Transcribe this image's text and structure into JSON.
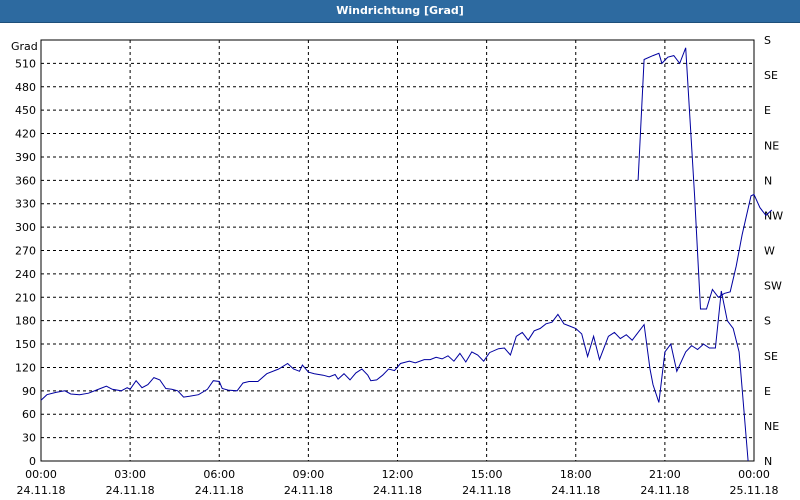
{
  "window": {
    "title": "Windrichtung [Grad]"
  },
  "chart_data": {
    "type": "line",
    "title": "Windrichtung [Grad]",
    "ylabel": "Grad",
    "xlabel": "",
    "ylim": [
      0,
      540
    ],
    "yticks": [
      0,
      30,
      60,
      90,
      120,
      150,
      180,
      210,
      240,
      270,
      300,
      330,
      360,
      390,
      420,
      450,
      480,
      510
    ],
    "xlim_hours": [
      0,
      24
    ],
    "xticks": [
      {
        "hour": 0,
        "time": "00:00",
        "date": "24.11.18"
      },
      {
        "hour": 3,
        "time": "03:00",
        "date": "24.11.18"
      },
      {
        "hour": 6,
        "time": "06:00",
        "date": "24.11.18"
      },
      {
        "hour": 9,
        "time": "09:00",
        "date": "24.11.18"
      },
      {
        "hour": 12,
        "time": "12:00",
        "date": "24.11.18"
      },
      {
        "hour": 15,
        "time": "15:00",
        "date": "24.11.18"
      },
      {
        "hour": 18,
        "time": "18:00",
        "date": "24.11.18"
      },
      {
        "hour": 21,
        "time": "21:00",
        "date": "24.11.18"
      },
      {
        "hour": 24,
        "time": "00:00",
        "date": "25.11.18"
      }
    ],
    "right_axis": [
      {
        "value": 0,
        "label": "N"
      },
      {
        "value": 45,
        "label": "NE"
      },
      {
        "value": 90,
        "label": "E"
      },
      {
        "value": 135,
        "label": "SE"
      },
      {
        "value": 180,
        "label": "S"
      },
      {
        "value": 225,
        "label": "SW"
      },
      {
        "value": 270,
        "label": "W"
      },
      {
        "value": 315,
        "label": "NW"
      },
      {
        "value": 360,
        "label": "N"
      },
      {
        "value": 405,
        "label": "NE"
      },
      {
        "value": 450,
        "label": "E"
      },
      {
        "value": 495,
        "label": "SE"
      },
      {
        "value": 540,
        "label": "S"
      }
    ],
    "grid": true,
    "colors": {
      "line": "#0000a0",
      "grid": "#000000",
      "titlebar": "#2d6aa0"
    },
    "series": [
      {
        "segments": [
          [
            [
              0,
              78
            ],
            [
              0.2,
              85
            ],
            [
              0.5,
              88
            ],
            [
              0.8,
              90
            ],
            [
              1.0,
              86
            ],
            [
              1.3,
              85
            ],
            [
              1.6,
              87
            ],
            [
              2.0,
              93
            ],
            [
              2.2,
              96
            ],
            [
              2.4,
              92
            ],
            [
              2.7,
              90
            ],
            [
              2.9,
              94
            ],
            [
              3.0,
              92
            ],
            [
              3.2,
              103
            ],
            [
              3.4,
              94
            ],
            [
              3.6,
              98
            ],
            [
              3.8,
              107
            ],
            [
              4.0,
              104
            ],
            [
              4.2,
              93
            ],
            [
              4.4,
              92
            ],
            [
              4.6,
              90
            ],
            [
              4.8,
              82
            ],
            [
              5.0,
              83
            ],
            [
              5.3,
              85
            ],
            [
              5.6,
              92
            ],
            [
              5.8,
              103
            ],
            [
              6.0,
              102
            ],
            [
              6.1,
              93
            ],
            [
              6.3,
              91
            ],
            [
              6.6,
              90
            ],
            [
              6.8,
              100
            ],
            [
              7.0,
              102
            ],
            [
              7.3,
              102
            ],
            [
              7.6,
              112
            ],
            [
              8.0,
              118
            ],
            [
              8.3,
              125
            ],
            [
              8.5,
              118
            ],
            [
              8.7,
              115
            ],
            [
              8.8,
              123
            ],
            [
              9.0,
              114
            ],
            [
              9.2,
              112
            ],
            [
              9.5,
              110
            ],
            [
              9.7,
              108
            ],
            [
              9.9,
              111
            ],
            [
              10.0,
              105
            ],
            [
              10.2,
              112
            ],
            [
              10.4,
              104
            ],
            [
              10.6,
              113
            ],
            [
              10.8,
              118
            ],
            [
              11.0,
              110
            ],
            [
              11.1,
              103
            ],
            [
              11.3,
              104
            ],
            [
              11.5,
              110
            ],
            [
              11.7,
              118
            ],
            [
              11.9,
              116
            ],
            [
              12.1,
              125
            ],
            [
              12.4,
              128
            ],
            [
              12.6,
              126
            ],
            [
              12.9,
              130
            ],
            [
              13.1,
              130
            ],
            [
              13.3,
              133
            ],
            [
              13.5,
              131
            ],
            [
              13.7,
              135
            ],
            [
              13.9,
              128
            ],
            [
              14.1,
              138
            ],
            [
              14.3,
              127
            ],
            [
              14.5,
              140
            ],
            [
              14.7,
              136
            ],
            [
              14.9,
              128
            ],
            [
              15.1,
              139
            ],
            [
              15.4,
              144
            ],
            [
              15.6,
              145
            ],
            [
              15.8,
              136
            ],
            [
              16.0,
              160
            ],
            [
              16.2,
              165
            ],
            [
              16.4,
              155
            ],
            [
              16.6,
              167
            ],
            [
              16.8,
              170
            ],
            [
              17.0,
              176
            ],
            [
              17.2,
              178
            ],
            [
              17.4,
              188
            ],
            [
              17.6,
              176
            ],
            [
              17.8,
              173
            ],
            [
              18.0,
              170
            ],
            [
              18.2,
              163
            ],
            [
              18.4,
              134
            ],
            [
              18.6,
              160
            ],
            [
              18.8,
              130
            ],
            [
              19.1,
              160
            ],
            [
              19.3,
              165
            ],
            [
              19.5,
              157
            ],
            [
              19.7,
              162
            ],
            [
              19.9,
              155
            ],
            [
              20.1,
              165
            ],
            [
              20.3,
              175
            ],
            [
              20.5,
              118
            ],
            [
              20.6,
              98
            ],
            [
              20.8,
              75
            ],
            [
              21.0,
              140
            ],
            [
              21.2,
              150
            ],
            [
              21.4,
              115
            ],
            [
              21.7,
              140
            ],
            [
              21.9,
              148
            ],
            [
              22.1,
              143
            ],
            [
              22.3,
              150
            ],
            [
              22.5,
              145
            ],
            [
              22.7,
              145
            ],
            [
              22.9,
              218
            ],
            [
              23.1,
              180
            ],
            [
              23.3,
              170
            ],
            [
              23.5,
              140
            ],
            [
              23.8,
              0
            ]
          ],
          [
            [
              20.1,
              360
            ],
            [
              20.3,
              515
            ],
            [
              20.6,
              520
            ],
            [
              20.8,
              523
            ],
            [
              20.9,
              510
            ],
            [
              21.1,
              518
            ],
            [
              21.3,
              520
            ],
            [
              21.5,
              510
            ],
            [
              21.7,
              530
            ],
            [
              22.0,
              340
            ],
            [
              22.2,
              195
            ],
            [
              22.4,
              195
            ],
            [
              22.6,
              220
            ],
            [
              22.8,
              210
            ],
            [
              23.0,
              215
            ],
            [
              23.2,
              217
            ],
            [
              23.4,
              250
            ],
            [
              23.6,
              290
            ],
            [
              23.9,
              340
            ],
            [
              24.0,
              342
            ],
            [
              24.2,
              325
            ],
            [
              24.4,
              315
            ],
            [
              24.6,
              322
            ]
          ]
        ]
      }
    ]
  }
}
